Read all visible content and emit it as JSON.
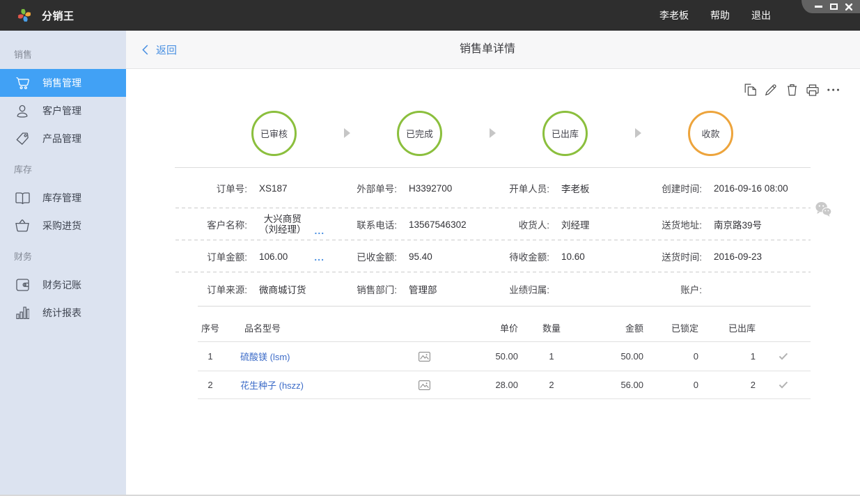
{
  "titlebar": {
    "app_title": "分销王",
    "menu": {
      "user": "李老板",
      "help": "帮助",
      "logout": "退出"
    }
  },
  "sidebar": {
    "sections": [
      {
        "label": "销售",
        "items": [
          {
            "label": "销售管理",
            "icon": "cart-icon",
            "active": true
          },
          {
            "label": "客户管理",
            "icon": "person-icon",
            "active": false
          },
          {
            "label": "产品管理",
            "icon": "tag-icon",
            "active": false
          }
        ]
      },
      {
        "label": "库存",
        "items": [
          {
            "label": "库存管理",
            "icon": "book-icon",
            "active": false
          },
          {
            "label": "采购进货",
            "icon": "basket-icon",
            "active": false
          }
        ]
      },
      {
        "label": "财务",
        "items": [
          {
            "label": "财务记账",
            "icon": "wallet-icon",
            "active": false
          },
          {
            "label": "统计报表",
            "icon": "bar-chart-icon",
            "active": false
          }
        ]
      }
    ]
  },
  "header": {
    "back_label": "返回",
    "title": "销售单详情"
  },
  "toolbar": {
    "icons": [
      "copy-icon",
      "edit-icon",
      "delete-icon",
      "print-icon",
      "more-icon"
    ]
  },
  "steps": [
    {
      "label": "已审核",
      "color": "#8bbf3d"
    },
    {
      "label": "已完成",
      "color": "#8bbf3d"
    },
    {
      "label": "已出库",
      "color": "#8bbf3d"
    },
    {
      "label": "收款",
      "color": "#eda43c"
    }
  ],
  "order_info": {
    "row1": [
      {
        "label": "订单号:",
        "value": "XS187"
      },
      {
        "label": "外部单号:",
        "value": "H3392700"
      },
      {
        "label": "开单人员:",
        "value": "李老板"
      },
      {
        "label": "创建时间:",
        "value": "2016-09-16 08:00"
      }
    ],
    "row2": [
      {
        "label": "客户名称:",
        "value_line1": "大兴商贸",
        "value_line2": "（刘经理）",
        "more": "..."
      },
      {
        "label": "联系电话:",
        "value": "13567546302"
      },
      {
        "label": "收货人:",
        "value": "刘经理"
      },
      {
        "label": "送货地址:",
        "value": "南京路39号"
      }
    ],
    "row3": [
      {
        "label": "订单金额:",
        "value": "106.00",
        "more": "..."
      },
      {
        "label": "已收金额:",
        "value": "95.40"
      },
      {
        "label": "待收金额:",
        "value": "10.60"
      },
      {
        "label": "送货时间:",
        "value": "2016-09-23"
      }
    ],
    "row4": [
      {
        "label": "订单来源:",
        "value": "微商城订货"
      },
      {
        "label": "销售部门:",
        "value": "管理部"
      },
      {
        "label": "业绩归属:",
        "value": ""
      },
      {
        "label": "账户:",
        "value": ""
      }
    ]
  },
  "items_table": {
    "headers": [
      "序号",
      "品名型号",
      "单价",
      "数量",
      "金额",
      "已锁定",
      "已出库"
    ],
    "rows": [
      {
        "seq": "1",
        "name": "硫酸镁 (lsm)",
        "price": "50.00",
        "qty": "1",
        "amount": "50.00",
        "locked": "0",
        "shipped": "1"
      },
      {
        "seq": "2",
        "name": "花生种子 (hszz)",
        "price": "28.00",
        "qty": "2",
        "amount": "56.00",
        "locked": "0",
        "shipped": "2"
      }
    ]
  },
  "colors": {
    "accent_blue": "#41a1f5",
    "step_green": "#8bbf3d",
    "step_orange": "#eda43c",
    "link_blue": "#4a90e2",
    "product_link_blue": "#3d6cc8"
  }
}
